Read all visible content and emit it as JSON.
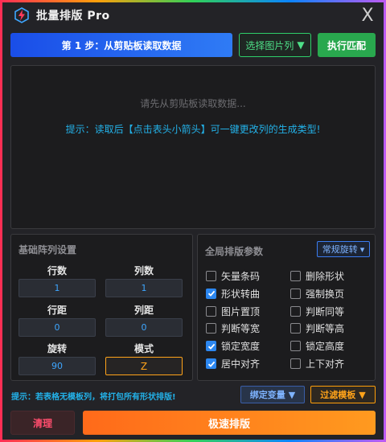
{
  "app": {
    "title": "批量排版 Pro",
    "close_glyph": "X"
  },
  "topbar": {
    "step_label": "第 1 步：从剪贴板读取数据",
    "select_column_label": "选择图片列",
    "select_column_arrow": "▼",
    "run_match_label": "执行匹配"
  },
  "data_area": {
    "placeholder": "请先从剪贴板读取数据...",
    "hint": "提示：读取后【点击表头小箭头】可一键更改列的生成类型!"
  },
  "array_settings": {
    "title": "基础阵列设置",
    "rows_label": "行数",
    "rows_value": "1",
    "cols_label": "列数",
    "cols_value": "1",
    "row_gap_label": "行距",
    "row_gap_value": "0",
    "col_gap_label": "列距",
    "col_gap_value": "0",
    "rotate_label": "旋转",
    "rotate_value": "90",
    "mode_label": "模式",
    "mode_value": "Z"
  },
  "global_params": {
    "title": "全局排版参数",
    "rotate_mode": "常规旋转",
    "rotate_mode_arrow": "▾",
    "options": [
      {
        "label": "矢量条码",
        "checked": false
      },
      {
        "label": "删除形状",
        "checked": false
      },
      {
        "label": "形状转曲",
        "checked": true
      },
      {
        "label": "强制换页",
        "checked": false
      },
      {
        "label": "图片置顶",
        "checked": false
      },
      {
        "label": "判断同等",
        "checked": false
      },
      {
        "label": "判断等宽",
        "checked": false
      },
      {
        "label": "判断等高",
        "checked": false
      },
      {
        "label": "锁定宽度",
        "checked": true
      },
      {
        "label": "锁定高度",
        "checked": false
      },
      {
        "label": "居中对齐",
        "checked": true
      },
      {
        "label": "上下对齐",
        "checked": false
      }
    ]
  },
  "footer": {
    "hint": "提示：若表格无模板列，将打包所有形状排版!",
    "bind_label": "绑定变量",
    "filter_label": "过滤模板",
    "dropdown_arrow": "▼",
    "clear_label": "清理",
    "go_label": "极速排版"
  },
  "colors": {
    "accent_blue": "#2c87f0",
    "accent_green": "#29a84e",
    "accent_orange": "#ff8c1a",
    "hint_cyan": "#23b1e8",
    "danger_red": "#ff4d6d"
  }
}
